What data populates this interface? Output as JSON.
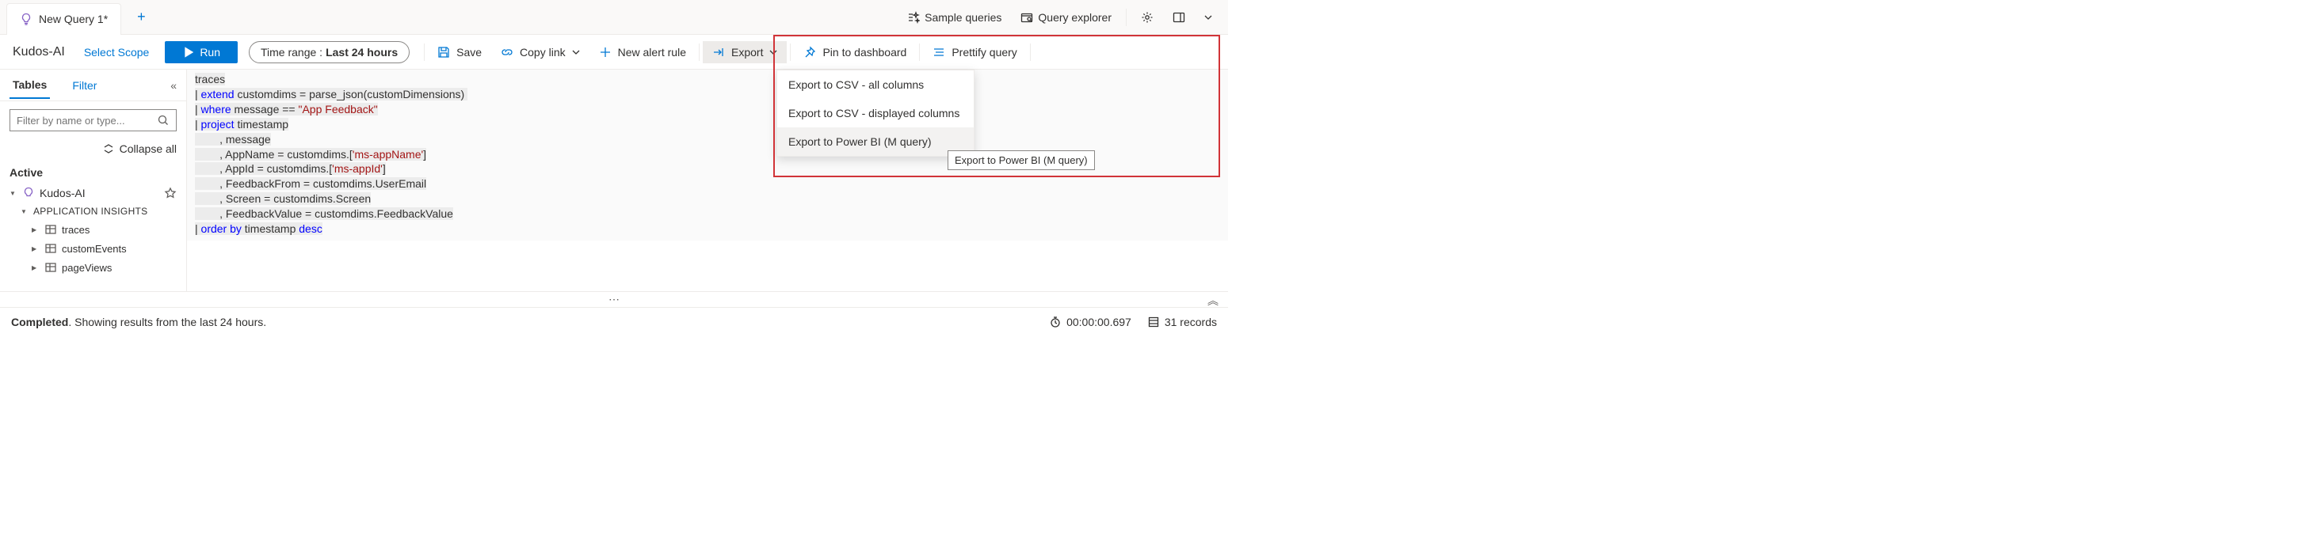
{
  "tab": {
    "title": "New Query 1*"
  },
  "header_right": {
    "sample": "Sample queries",
    "explorer": "Query explorer"
  },
  "toolbar": {
    "app_name": "Kudos-AI",
    "select_scope": "Select Scope",
    "run": "Run",
    "time_label": "Time range : ",
    "time_value": "Last 24 hours",
    "save": "Save",
    "copy_link": "Copy link",
    "new_alert": "New alert rule",
    "export": "Export",
    "pin": "Pin to dashboard",
    "prettify": "Prettify query"
  },
  "export_menu": {
    "csv_all": "Export to CSV - all columns",
    "csv_disp": "Export to CSV - displayed columns",
    "powerbi": "Export to Power BI (M query)",
    "tooltip": "Export to Power BI (M query)"
  },
  "sidebar": {
    "tab_tables": "Tables",
    "tab_filter": "Filter",
    "search_placeholder": "Filter by name or type...",
    "collapse_all": "Collapse all",
    "section_active": "Active",
    "tree_root": "Kudos-AI",
    "tree_group": "APPLICATION INSIGHTS",
    "tree_items": [
      "traces",
      "customEvents",
      "pageViews"
    ]
  },
  "editor": {
    "l1": "traces",
    "l2a": "| ",
    "l2b": "extend",
    "l2c": " customdims = parse_json(customDimensions) ",
    "l3a": "| ",
    "l3b": "where",
    "l3c": " message == ",
    "l3d": "\"App Feedback\"",
    "l4a": "| ",
    "l4b": "project",
    "l4c": " timestamp",
    "l5": "        , message",
    "l6a": "        , AppName = customdims.[",
    "l6b": "'ms-appName'",
    "l6c": "]",
    "l7a": "        , AppId = customdims.[",
    "l7b": "'ms-appId'",
    "l7c": "]",
    "l8": "        , FeedbackFrom = customdims.UserEmail",
    "l9": "        , Screen = customdims.Screen",
    "l10": "        , FeedbackValue = customdims.FeedbackValue",
    "l11a": "| ",
    "l11b": "order by",
    "l11c": " timestamp ",
    "l11d": "desc"
  },
  "status": {
    "completed": "Completed",
    "detail": ". Showing results from the last 24 hours.",
    "time": "00:00:00.697",
    "records": "31 records"
  }
}
